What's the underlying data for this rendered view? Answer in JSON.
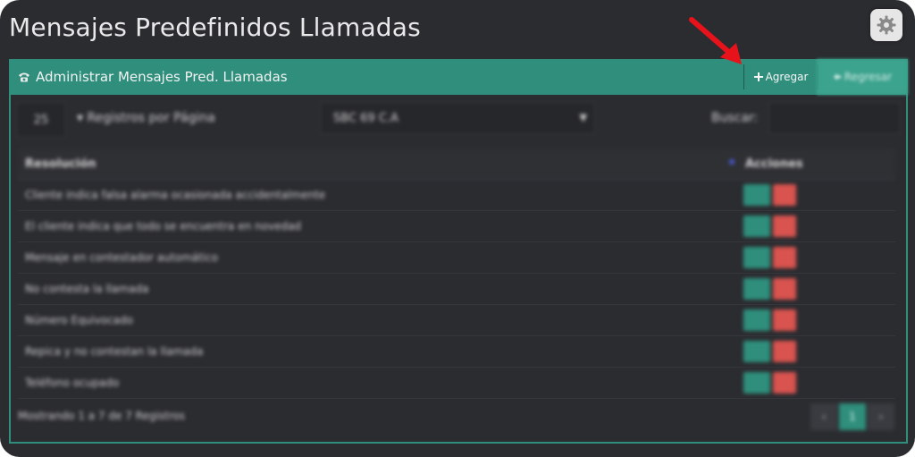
{
  "page": {
    "title": "Mensajes Predefinidos Llamadas"
  },
  "panel": {
    "title": "Administrar Mensajes Pred. Llamadas",
    "add_label": "Agregar",
    "return_label": "Regresar"
  },
  "controls": {
    "per_page_value": "25",
    "per_page_label": "Registros por Página",
    "company_value": "SBC 69 C.A",
    "search_label": "Buscar:",
    "search_value": ""
  },
  "table": {
    "columns": [
      "Resolución",
      "Acciones"
    ],
    "rows": [
      {
        "text": "Cliente indica falsa alarma ocasionada accidentalmente",
        "edit": "",
        "delete": ""
      },
      {
        "text": "El cliente indica que todo se encuentra en novedad",
        "edit": "",
        "delete": ""
      },
      {
        "text": "Mensaje en contestador automático",
        "edit": "",
        "delete": ""
      },
      {
        "text": "No contesta la llamada",
        "edit": "",
        "delete": ""
      },
      {
        "text": "Número Equivocado",
        "edit": "",
        "delete": ""
      },
      {
        "text": "Repica y no contestan la llamada",
        "edit": "",
        "delete": ""
      },
      {
        "text": "Teléfono ocupado",
        "edit": "",
        "delete": ""
      }
    ]
  },
  "footer": {
    "info": "Mostrando 1 a 7 de 7 Registros",
    "pagination": [
      "‹",
      "1",
      "›"
    ],
    "current_page": "1"
  },
  "colors": {
    "accent": "#2f8f7c",
    "danger": "#d9534f",
    "background": "#2b2c30",
    "arrow": "#e8121b"
  },
  "icons": {
    "settings": "gear-icon",
    "phone": "phone-icon",
    "add": "plus-icon",
    "return": "return-icon"
  }
}
